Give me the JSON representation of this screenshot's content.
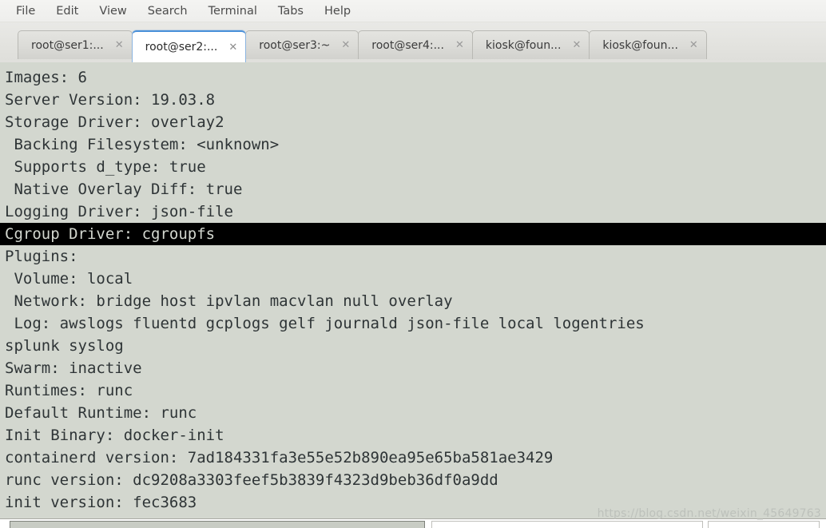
{
  "window": {
    "app": "Terminal",
    "bg_color": "#d3d7cf",
    "text_color": "#2e3436",
    "accent_color": "#4a90d9"
  },
  "menubar": {
    "items": [
      {
        "label": "File"
      },
      {
        "label": "Edit"
      },
      {
        "label": "View"
      },
      {
        "label": "Search"
      },
      {
        "label": "Terminal"
      },
      {
        "label": "Tabs"
      },
      {
        "label": "Help"
      }
    ]
  },
  "tabs": {
    "close_glyph": "✕",
    "items": [
      {
        "label": "root@ser1:...",
        "active": false
      },
      {
        "label": "root@ser2:...",
        "active": true
      },
      {
        "label": "root@ser3:~",
        "active": false
      },
      {
        "label": "root@ser4:...",
        "active": false
      },
      {
        "label": "kiosk@foun...",
        "active": false
      },
      {
        "label": "kiosk@foun...",
        "active": false
      }
    ]
  },
  "terminal": {
    "lines": [
      {
        "text": "Images: 6",
        "highlight": false
      },
      {
        "text": "Server Version: 19.03.8",
        "highlight": false
      },
      {
        "text": "Storage Driver: overlay2",
        "highlight": false
      },
      {
        "text": " Backing Filesystem: <unknown>",
        "highlight": false
      },
      {
        "text": " Supports d_type: true",
        "highlight": false
      },
      {
        "text": " Native Overlay Diff: true",
        "highlight": false
      },
      {
        "text": "Logging Driver: json-file",
        "highlight": false
      },
      {
        "text": "Cgroup Driver: cgroupfs",
        "highlight": true
      },
      {
        "text": "Plugins:",
        "highlight": false
      },
      {
        "text": " Volume: local",
        "highlight": false
      },
      {
        "text": " Network: bridge host ipvlan macvlan null overlay",
        "highlight": false
      },
      {
        "text": " Log: awslogs fluentd gcplogs gelf journald json-file local logentries",
        "highlight": false
      },
      {
        "text": "splunk syslog",
        "highlight": false
      },
      {
        "text": "Swarm: inactive",
        "highlight": false
      },
      {
        "text": "Runtimes: runc",
        "highlight": false
      },
      {
        "text": "Default Runtime: runc",
        "highlight": false
      },
      {
        "text": "Init Binary: docker-init",
        "highlight": false
      },
      {
        "text": "containerd version: 7ad184331fa3e55e52b890ea95e65ba581ae3429",
        "highlight": false
      },
      {
        "text": "runc version: dc9208a3303feef5b3839f4323d9beb36df0a9dd",
        "highlight": false
      },
      {
        "text": "init version: fec3683",
        "highlight": false
      }
    ]
  },
  "watermark": {
    "text": "https://blog.csdn.net/weixin_45649763"
  }
}
